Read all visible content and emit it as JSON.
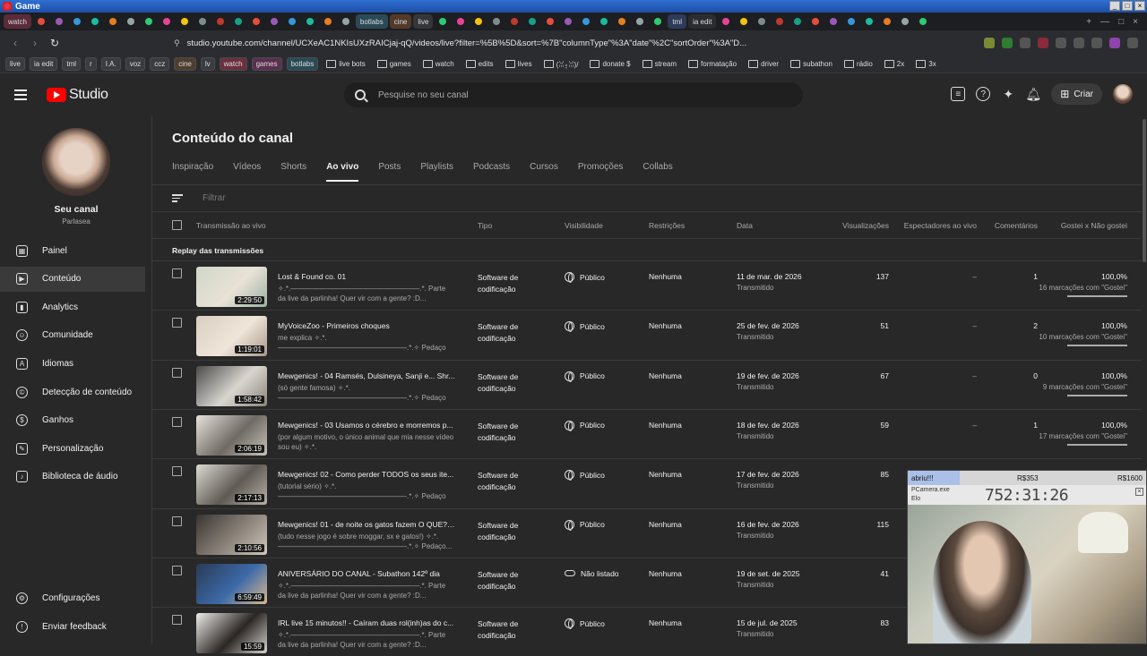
{
  "window": {
    "title": "Game"
  },
  "browser_tabs": [
    {
      "label": "watch",
      "kind": "watch"
    },
    {
      "label": "botlabs",
      "kind": "botlabs"
    },
    {
      "label": "cine",
      "kind": "cine"
    },
    {
      "label": "live",
      "kind": "named"
    },
    {
      "label": "tml",
      "kind": "tml"
    },
    {
      "label": "ia edit",
      "kind": "active"
    }
  ],
  "address": {
    "url": "studio.youtube.com/channel/UCXeAC1NKIsUXzRAICjaj-qQ/videos/live?filter=%5B%5D&sort=%7B\"columnType\"%3A\"date\"%2C\"sortOrder\"%3A\"D..."
  },
  "bookmarks": [
    {
      "label": "live",
      "style": "chip"
    },
    {
      "label": "ia edit",
      "style": "chip"
    },
    {
      "label": "tml",
      "style": "chip"
    },
    {
      "label": "r",
      "style": "chip"
    },
    {
      "label": "I.A.",
      "style": "chip"
    },
    {
      "label": "voz",
      "style": "chip"
    },
    {
      "label": "ccz",
      "style": "chip"
    },
    {
      "label": "cine",
      "style": "c-cine"
    },
    {
      "label": "lv",
      "style": "chip"
    },
    {
      "label": "watch",
      "style": "c-watch"
    },
    {
      "label": "games",
      "style": "c-games"
    },
    {
      "label": "botlabs",
      "style": "c-botlabs"
    },
    {
      "label": "live bots",
      "style": "folder"
    },
    {
      "label": "games",
      "style": "folder"
    },
    {
      "label": "watch",
      "style": "folder"
    },
    {
      "label": "edits",
      "style": "folder"
    },
    {
      "label": "lives",
      "style": "folder"
    },
    {
      "label": "(ꈍ⍛ꈍ)/",
      "style": "folder"
    },
    {
      "label": "donate $",
      "style": "folder"
    },
    {
      "label": "stream",
      "style": "folder"
    },
    {
      "label": "formatação",
      "style": "folder"
    },
    {
      "label": "driver",
      "style": "folder"
    },
    {
      "label": "subathon",
      "style": "folder"
    },
    {
      "label": "rádio",
      "style": "folder"
    },
    {
      "label": "2x",
      "style": "folder"
    },
    {
      "label": "3x",
      "style": "folder"
    }
  ],
  "header": {
    "logo_text": "Studio",
    "search_placeholder": "Pesquise no seu canal",
    "create_label": "Criar"
  },
  "sidebar": {
    "channel_name": "Seu canal",
    "channel_handle": "Parlasea",
    "items": [
      {
        "label": "Painel",
        "icon": "dashboard-icon",
        "glyph": "▦"
      },
      {
        "label": "Conteúdo",
        "icon": "content-icon",
        "glyph": "▶",
        "active": true
      },
      {
        "label": "Analytics",
        "icon": "analytics-icon",
        "glyph": "▮"
      },
      {
        "label": "Comunidade",
        "icon": "community-icon",
        "glyph": "☺"
      },
      {
        "label": "Idiomas",
        "icon": "languages-icon",
        "glyph": "A"
      },
      {
        "label": "Detecção de conteúdo",
        "icon": "content-detection-icon",
        "glyph": "©"
      },
      {
        "label": "Ganhos",
        "icon": "earnings-icon",
        "glyph": "$"
      },
      {
        "label": "Personalização",
        "icon": "customization-icon",
        "glyph": "✎"
      },
      {
        "label": "Biblioteca de áudio",
        "icon": "audio-library-icon",
        "glyph": "♪"
      }
    ],
    "bottom_items": [
      {
        "label": "Configurações",
        "icon": "settings-icon",
        "glyph": "⚙"
      },
      {
        "label": "Enviar feedback",
        "icon": "feedback-icon",
        "glyph": "!"
      }
    ]
  },
  "main": {
    "page_title": "Conteúdo do canal",
    "tabs": [
      "Inspiração",
      "Vídeos",
      "Shorts",
      "Ao vivo",
      "Posts",
      "Playlists",
      "Podcasts",
      "Cursos",
      "Promoções",
      "Collabs"
    ],
    "active_tab": "Ao vivo",
    "filter_placeholder": "Filtrar",
    "columns": {
      "video": "Transmissão ao vivo",
      "type": "Tipo",
      "visibility": "Visibilidade",
      "restrictions": "Restrições",
      "date": "Data",
      "views": "Visualizações",
      "viewers": "Espectadores ao vivo",
      "comments": "Comentários",
      "likes": "Gostei x Não gostei"
    },
    "section_label": "Replay das transmissões",
    "rows": [
      {
        "title": "Lost & Found co. 01",
        "desc": "✧.*.——————————————————.*. Parte da live da parlinha! Quer vir com a gente? :D...",
        "duration": "2:29:50",
        "type": "Software de codificação",
        "visibility": "Público",
        "vis_icon": "globe",
        "restrictions": "Nenhuma",
        "date": "11 de mar. de 2026",
        "date_sub": "Transmitido",
        "views": "137",
        "viewers": "–",
        "comments": "1",
        "likes": "100,0%",
        "likes_sub": "16 marcações com \"Gostei\"",
        "thumb": [
          "#cfd7c9",
          "#e9e2d6",
          "#9bb0a2"
        ]
      },
      {
        "title": "MyVoiceZoo - Primeiros choques",
        "desc": "me explica ✧.*.——————————————————.*.✧ Pedaço da live da Parlinha, quer vir com a...",
        "duration": "1:19:01",
        "type": "Software de codificação",
        "visibility": "Público",
        "vis_icon": "globe",
        "restrictions": "Nenhuma",
        "date": "25 de fev. de 2026",
        "date_sub": "Transmitido",
        "views": "51",
        "viewers": "–",
        "comments": "2",
        "likes": "100,0%",
        "likes_sub": "10 marcações com \"Gostei\"",
        "thumb": [
          "#d8cfc2",
          "#efe6d9",
          "#a8978a"
        ]
      },
      {
        "title": "Mewgenics! - 04 Ramsés, Dulsineya, Sanji e... Shr...",
        "desc": "(só gente famosa) ✧.*.——————————————————.*.✧ Pedaço da live da Parlinha, quer v...",
        "duration": "1:58:42",
        "type": "Software de codificação",
        "visibility": "Público",
        "vis_icon": "globe",
        "restrictions": "Nenhuma",
        "date": "19 de fev. de 2026",
        "date_sub": "Transmitido",
        "views": "67",
        "viewers": "–",
        "comments": "0",
        "likes": "100,0%",
        "likes_sub": "9 marcações com \"Gostei\"",
        "thumb": [
          "#4a4a4a",
          "#d9d6cf",
          "#8a8378"
        ]
      },
      {
        "title": "Mewgenics! - 03 Usamos o cérebro e morremos p...",
        "desc": "(por algum motivo, o único animal que mia nesse vídeo sou eu) ✧.*.——————————————————.*...",
        "duration": "2:06:19",
        "type": "Software de codificação",
        "visibility": "Público",
        "vis_icon": "globe",
        "restrictions": "Nenhuma",
        "date": "18 de fev. de 2026",
        "date_sub": "Transmitido",
        "views": "59",
        "viewers": "–",
        "comments": "1",
        "likes": "100,0%",
        "likes_sub": "17 marcações com \"Gostei\"",
        "thumb": [
          "#e6e3dc",
          "#6f6a64",
          "#c9c3ba"
        ]
      },
      {
        "title": "Mewgenics! 02 - Como perder TODOS os seus ite...",
        "desc": "(tutorial sério) ✧.*.——————————————————.*.✧ Pedaço da live da Parlinha, quer vir...",
        "duration": "2:17:13",
        "type": "Software de codificação",
        "visibility": "Público",
        "vis_icon": "globe",
        "restrictions": "Nenhuma",
        "date": "17 de fev. de 2026",
        "date_sub": "Transmitido",
        "views": "85",
        "viewers": "",
        "comments": "",
        "likes": "",
        "likes_sub": "",
        "thumb": [
          "#dcdad3",
          "#5f5a54",
          "#b7b1a8"
        ]
      },
      {
        "title": "Mewgenics! 01 - de noite os gatos fazem O QUE?!?!",
        "desc": "(tudo nesse jogo é sobre moggar, sx e gatos!) ✧.*.——————————————————.*.✧ Pedaço...",
        "duration": "2:10:56",
        "type": "Software de codificação",
        "visibility": "Público",
        "vis_icon": "globe",
        "restrictions": "Nenhuma",
        "date": "16 de fev. de 2026",
        "date_sub": "Transmitido",
        "views": "115",
        "viewers": "",
        "comments": "",
        "likes": "",
        "likes_sub": "",
        "thumb": [
          "#3a3532",
          "#8d847b",
          "#cfc8bd"
        ]
      },
      {
        "title": "ANIVERSÁRIO DO CANAL - Subathon 142º dia",
        "desc": "✧.*.——————————————————.*. Parte da live da parlinha! Quer vir com a gente? :D...",
        "duration": "6:59:49",
        "type": "Software de codificação",
        "visibility": "Não listado",
        "vis_icon": "link",
        "restrictions": "Nenhuma",
        "date": "19 de set. de 2025",
        "date_sub": "Transmitido",
        "views": "41",
        "viewers": "",
        "comments": "",
        "likes": "",
        "likes_sub": "",
        "thumb": [
          "#2a3a55",
          "#3c6aa8",
          "#d9b98f"
        ]
      },
      {
        "title": "IRL live 15 minutos!! - Caíram duas rol(inh)as do c...",
        "desc": "✧.*.——————————————————.*. Parte da live da parlinha! Quer vir com a gente? :D...",
        "duration": "15:59",
        "type": "Software de codificação",
        "visibility": "Público",
        "vis_icon": "globe",
        "restrictions": "Nenhuma",
        "date": "15 de jul. de 2025",
        "date_sub": "Transmitido",
        "views": "83",
        "viewers": "",
        "comments": "",
        "likes": "",
        "likes_sub": "",
        "thumb": [
          "#efeeea",
          "#2b2624",
          "#d8d5ce"
        ]
      }
    ]
  },
  "overlay": {
    "label_a": "abriu!!!",
    "label_b": "R$353",
    "label_c": "R$1600",
    "window_name": "PCamera.exe",
    "sub": "Elo",
    "timer": "752:31:26"
  }
}
